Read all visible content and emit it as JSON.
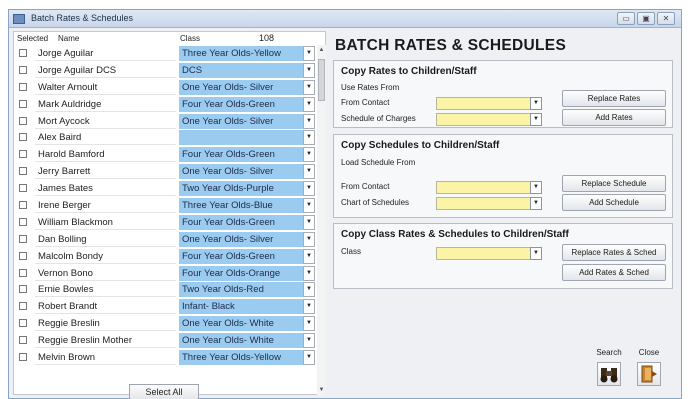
{
  "window": {
    "title": "Batch Rates & Schedules"
  },
  "window_controls": {
    "minimize": "▭",
    "maximize": "▣",
    "close": "✕"
  },
  "list": {
    "header_selected": "Selected",
    "header_name": "Name",
    "header_class": "Class",
    "count": "108",
    "rows": [
      {
        "name": "Jorge Aguilar",
        "class": "Three Year Olds-Yellow"
      },
      {
        "name": "Jorge Aguilar DCS",
        "class": "DCS"
      },
      {
        "name": "Walter Arnoult",
        "class": "One Year Olds- Silver"
      },
      {
        "name": "Mark Auldridge",
        "class": "Four Year Olds-Green"
      },
      {
        "name": "Mort Aycock",
        "class": "One Year Olds- Silver"
      },
      {
        "name": "Alex Baird",
        "class": ""
      },
      {
        "name": "Harold Bamford",
        "class": "Four Year Olds-Green"
      },
      {
        "name": "Jerry Barrett",
        "class": "One Year Olds- Silver"
      },
      {
        "name": "James Bates",
        "class": "Two Year Olds-Purple"
      },
      {
        "name": "Irene Berger",
        "class": "Three Year Olds-Blue"
      },
      {
        "name": "William Blackmon",
        "class": "Four Year Olds-Green"
      },
      {
        "name": "Dan Bolling",
        "class": "One Year Olds- Silver"
      },
      {
        "name": "Malcolm Bondy",
        "class": "Four Year Olds-Green"
      },
      {
        "name": "Vernon Bono",
        "class": "Four Year Olds-Orange"
      },
      {
        "name": "Ernie Bowles",
        "class": "Two Year Olds-Red"
      },
      {
        "name": "Robert Brandt",
        "class": "Infant- Black"
      },
      {
        "name": "Reggie Breslin",
        "class": "One Year Olds- White"
      },
      {
        "name": "Reggie Breslin Mother",
        "class": "One Year Olds- White"
      },
      {
        "name": "Melvin Brown",
        "class": "Three Year Olds-Yellow"
      }
    ],
    "select_all_label": "Select All"
  },
  "panel": {
    "title": "BATCH RATES & SCHEDULES",
    "rates": {
      "title": "Copy Rates to Children/Staff",
      "subtitle": "Use Rates From",
      "from_contact_label": "From Contact",
      "from_contact_value": "",
      "schedule_label": "Schedule of Charges",
      "schedule_value": "",
      "replace_label": "Replace Rates",
      "add_label": "Add Rates"
    },
    "schedules": {
      "title": "Copy Schedules to Children/Staff",
      "subtitle": "Load Schedule From",
      "from_contact_label": "From Contact",
      "from_contact_value": "",
      "chart_label": "Chart of Schedules",
      "chart_value": "",
      "replace_label": "Replace Schedule",
      "add_label": "Add Schedule"
    },
    "class_copy": {
      "title": "Copy Class Rates & Schedules to Children/Staff",
      "class_label": "Class",
      "class_value": "",
      "replace_label": "Replace Rates & Sched",
      "add_label": "Add Rates & Sched"
    },
    "search_label": "Search",
    "close_label": "Close"
  },
  "colors": {
    "class_fill": "#9ccbf0",
    "combo_fill": "#fbf4a6"
  }
}
